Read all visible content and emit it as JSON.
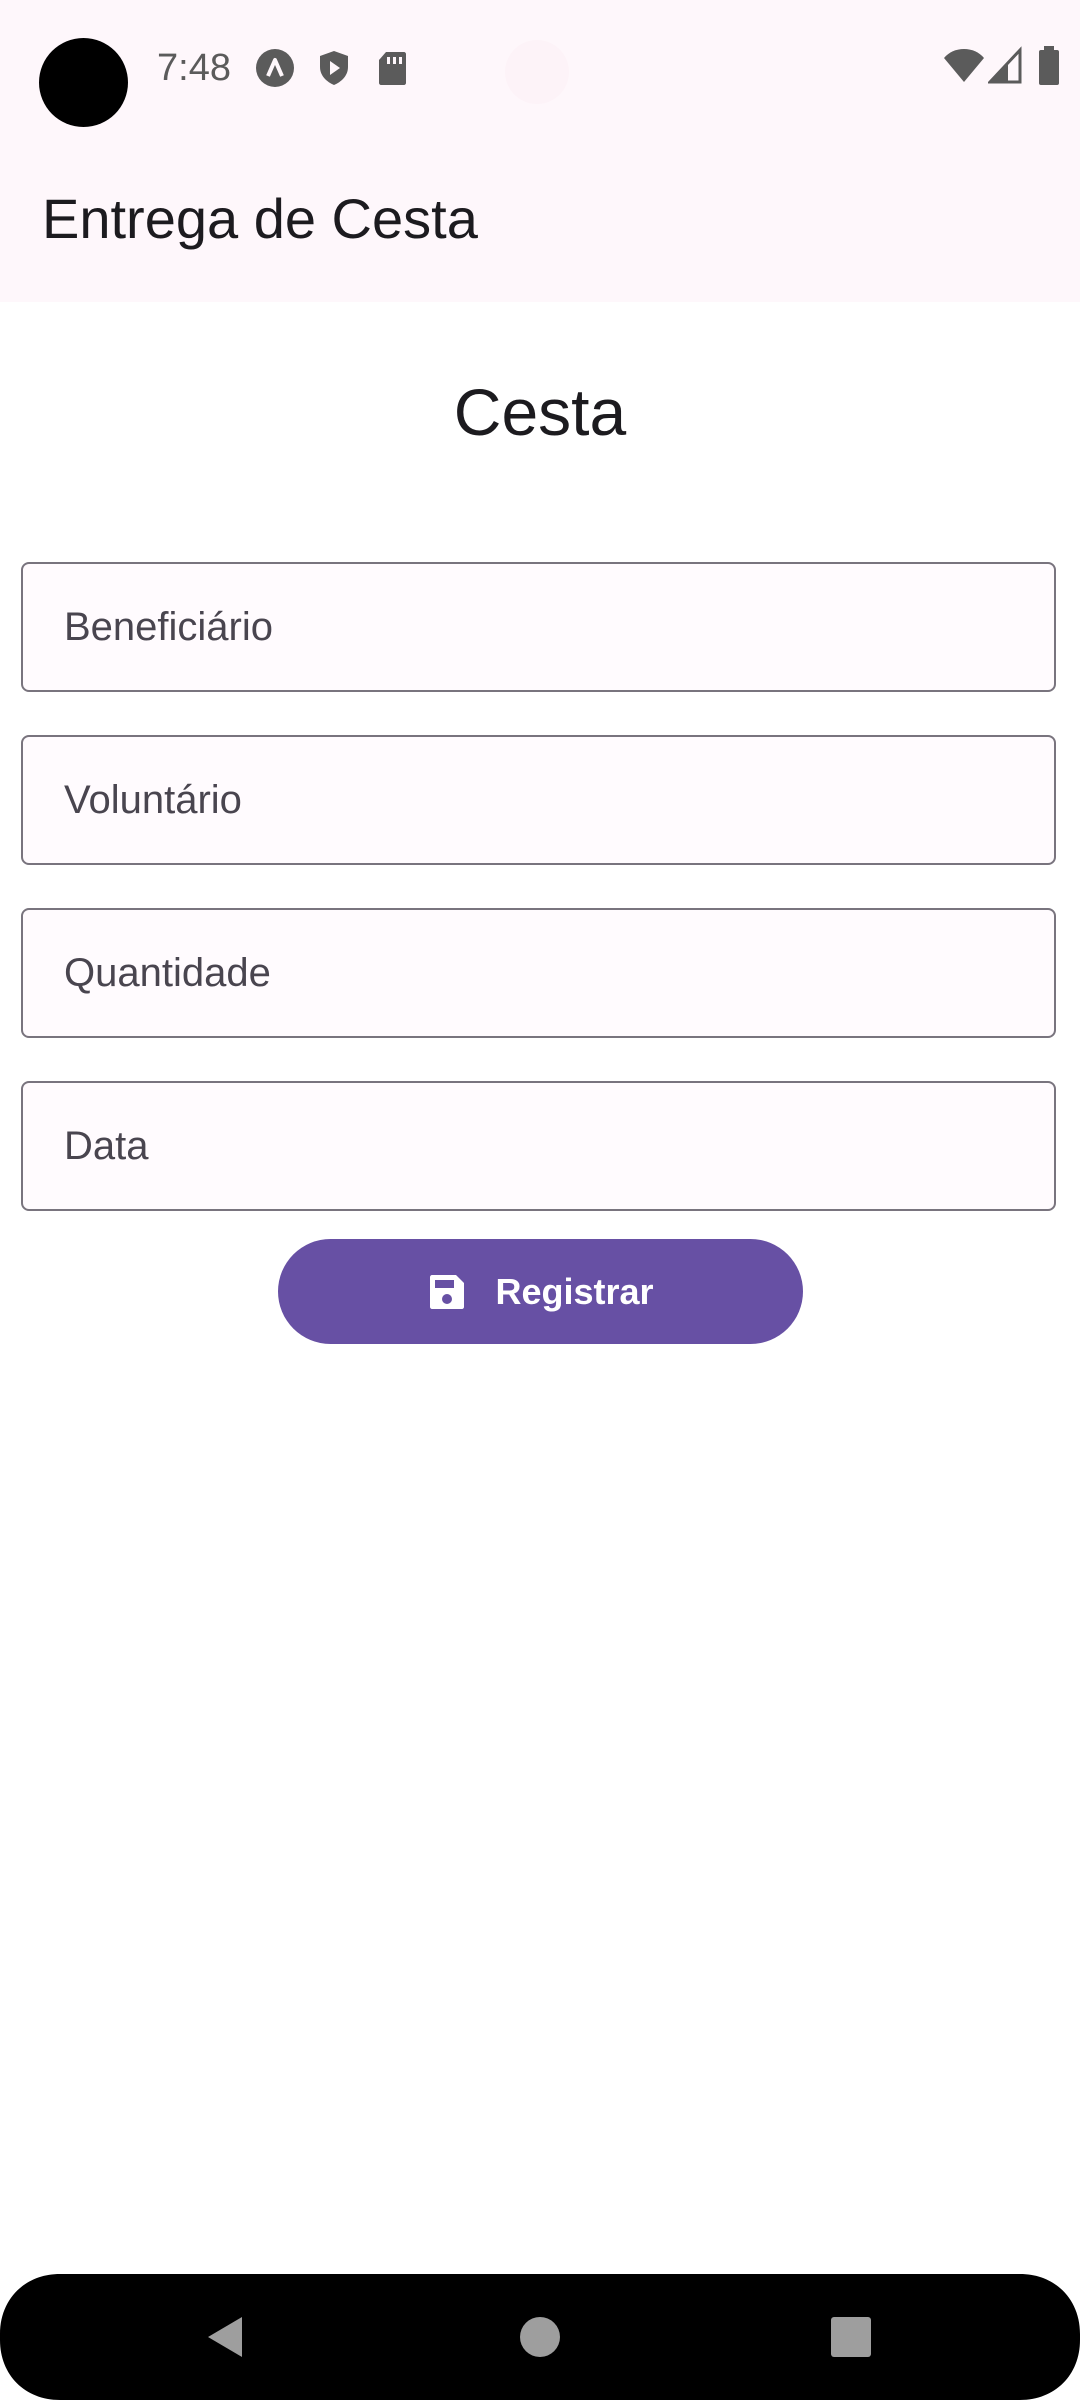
{
  "status_bar": {
    "time": "7:48",
    "left_icons": [
      "app-notification-icon",
      "shield-play-icon",
      "sd-card-icon"
    ],
    "right_icons": [
      "wifi-icon",
      "cellular-signal-icon",
      "battery-icon"
    ]
  },
  "app_bar": {
    "title": "Entrega de Cesta"
  },
  "form": {
    "heading": "Cesta",
    "fields": [
      {
        "name": "beneficiario",
        "placeholder": "Beneficiário",
        "value": ""
      },
      {
        "name": "voluntario",
        "placeholder": "Voluntário",
        "value": ""
      },
      {
        "name": "quantidade",
        "placeholder": "Quantidade",
        "value": ""
      },
      {
        "name": "data",
        "placeholder": "Data",
        "value": ""
      }
    ],
    "submit": {
      "label": "Registrar",
      "icon": "save-icon"
    }
  },
  "navigation": {
    "buttons": [
      "back-icon",
      "home-icon",
      "recents-icon"
    ]
  },
  "colors": {
    "primary": "#6750a4",
    "surface": "#fef7fb",
    "outline": "#79747e",
    "on_surface": "#1c1b1f"
  }
}
